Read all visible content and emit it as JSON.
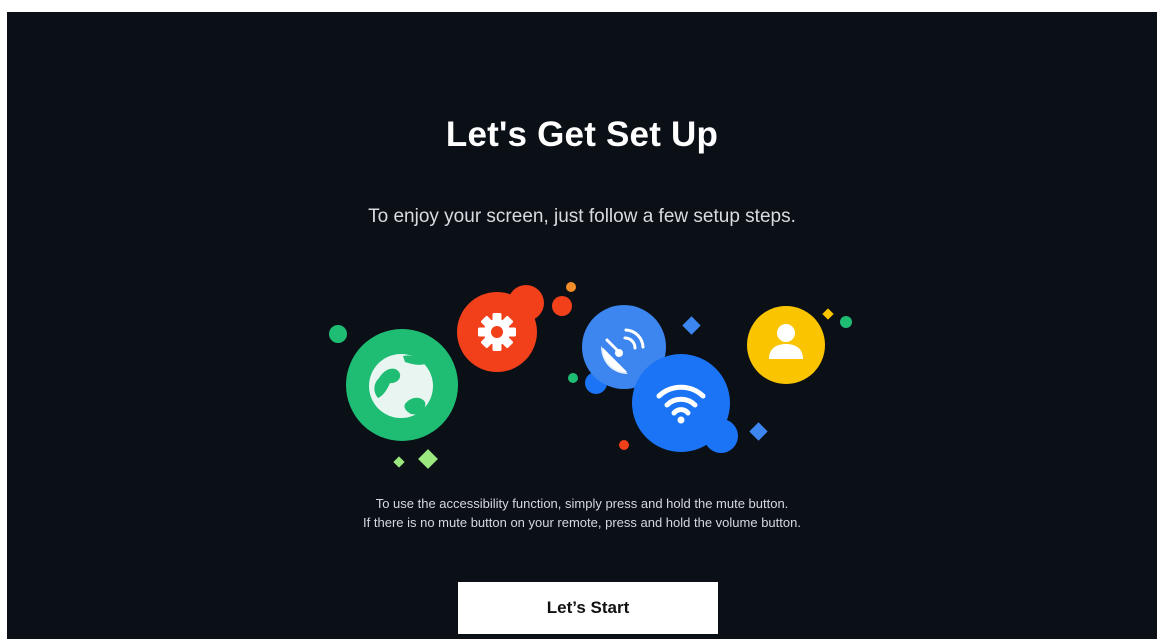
{
  "setup": {
    "title": "Let's Get Set Up",
    "subtitle": "To enjoy your screen, just follow a few setup steps.",
    "accessibility_note": [
      "To use the accessibility function, simply press and hold the mute button.",
      "If there is no mute button on your remote, press and hold the volume button."
    ],
    "start_button_label": "Let’s Start"
  },
  "illustration": {
    "icons": [
      "globe-icon",
      "gear-icon",
      "satellite-dish-icon",
      "wifi-icon",
      "user-icon"
    ],
    "colors": {
      "background": "#0b0f16",
      "globe": "#1fbd74",
      "gear": "#f2401a",
      "satellite": "#3d86f0",
      "wifi": "#1b74f5",
      "user": "#fbc400",
      "button": "#ffffff"
    }
  }
}
